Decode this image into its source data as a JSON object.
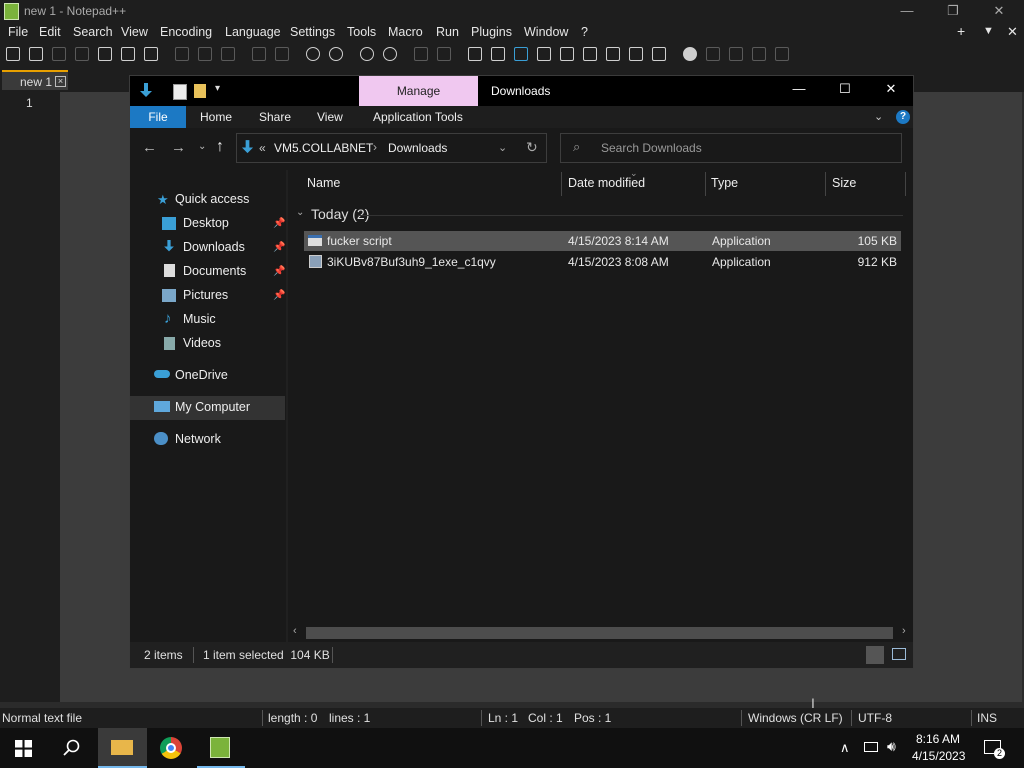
{
  "npp": {
    "title": "new 1 - Notepad++",
    "menu": [
      "File",
      "Edit",
      "Search",
      "View",
      "Encoding",
      "Language",
      "Settings",
      "Tools",
      "Macro",
      "Run",
      "Plugins",
      "Window",
      "?"
    ],
    "tab_label": "new 1",
    "line_number": "1",
    "status": {
      "type": "Normal text file",
      "length": "length : 0",
      "lines": "lines : 1",
      "ln": "Ln : 1",
      "col": "Col : 1",
      "pos": "Pos : 1",
      "eol": "Windows (CR LF)",
      "encoding": "UTF-8",
      "mode": "INS"
    }
  },
  "explorer": {
    "manage_label": "Manage",
    "title": "Downloads",
    "ribbon": [
      "File",
      "Home",
      "Share",
      "View",
      "Application Tools"
    ],
    "breadcrumb": {
      "prefix": "«",
      "part1": "VM5.COLLABNET",
      "part2": "Downloads"
    },
    "search_placeholder": "Search Downloads",
    "nav": [
      {
        "label": "Quick access",
        "icon": "star-icon",
        "pinned": false
      },
      {
        "label": "Desktop",
        "icon": "desktop-icon",
        "pinned": true
      },
      {
        "label": "Downloads",
        "icon": "download-icon",
        "pinned": true
      },
      {
        "label": "Documents",
        "icon": "documents-icon",
        "pinned": true
      },
      {
        "label": "Pictures",
        "icon": "pictures-icon",
        "pinned": true
      },
      {
        "label": "Music",
        "icon": "music-icon",
        "pinned": false
      },
      {
        "label": "Videos",
        "icon": "videos-icon",
        "pinned": false
      },
      {
        "label": "OneDrive",
        "icon": "cloud-icon",
        "pinned": false
      },
      {
        "label": "My Computer",
        "icon": "computer-icon",
        "pinned": false
      },
      {
        "label": "Network",
        "icon": "network-icon",
        "pinned": false
      }
    ],
    "columns": [
      "Name",
      "Date modified",
      "Type",
      "Size"
    ],
    "group_label": "Today (2)",
    "files": [
      {
        "name": "fucker script",
        "date": "4/15/2023 8:14 AM",
        "type": "Application",
        "size": "105 KB",
        "selected": true
      },
      {
        "name": "3iKUBv87Buf3uh9_1exe_c1qvy",
        "date": "4/15/2023 8:08 AM",
        "type": "Application",
        "size": "912 KB",
        "selected": false
      }
    ],
    "status": {
      "items": "2 items",
      "selected": "1 item selected  104 KB"
    }
  },
  "taskbar": {
    "time": "8:16 AM",
    "date": "4/15/2023"
  },
  "colors": {
    "accent": "#1c79c4",
    "manage_tab": "#f0c8f0",
    "selected_row": "#555555",
    "npp_tab_marker": "#e8a000"
  }
}
